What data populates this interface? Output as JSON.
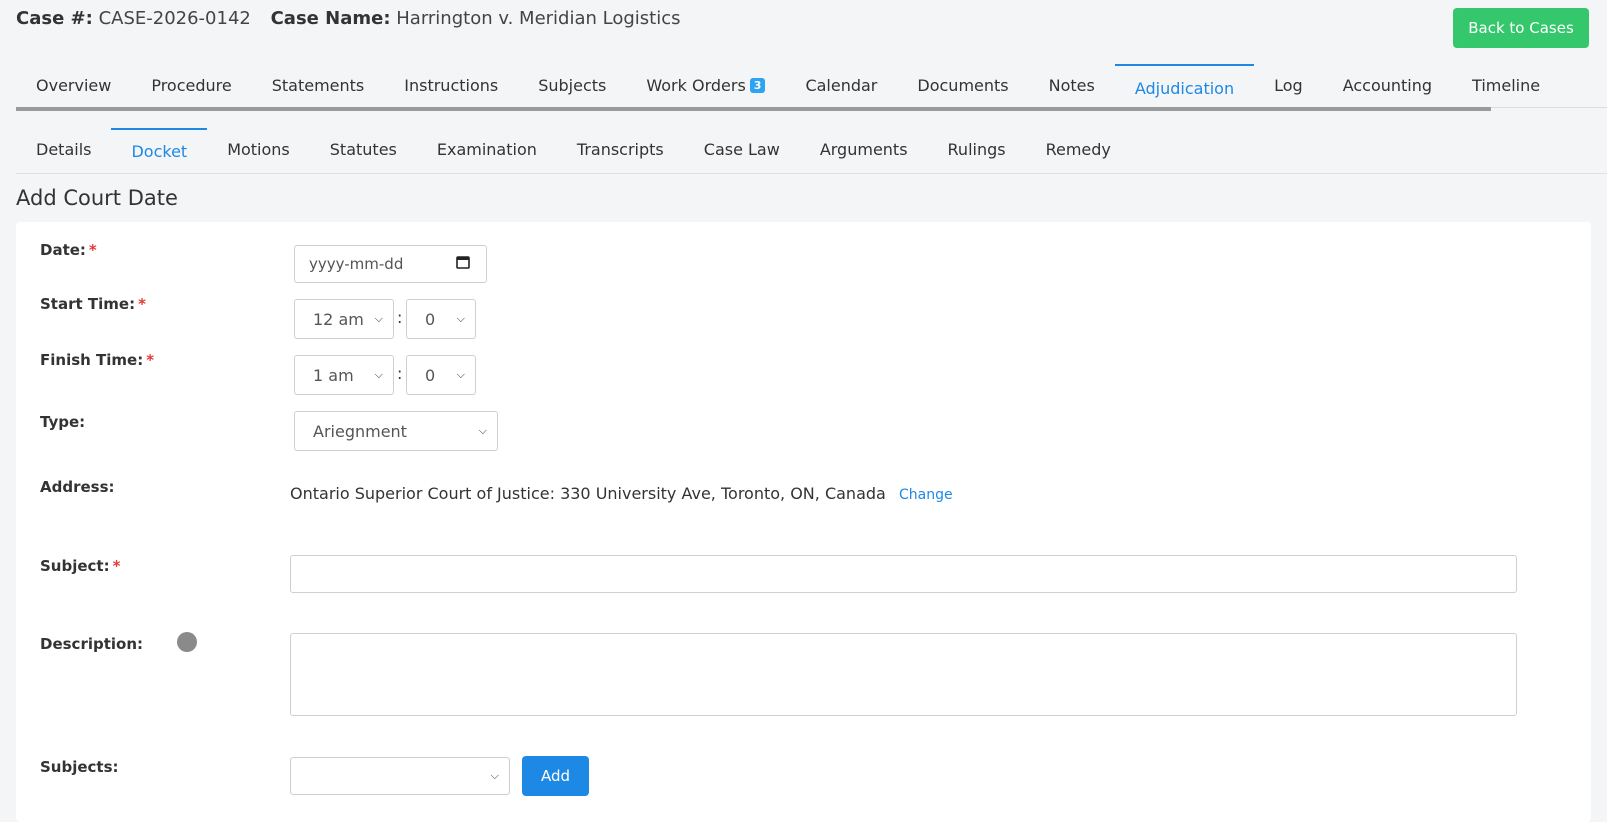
{
  "header": {
    "case_no_label": "Case #:",
    "case_no": "CASE-2026-0142",
    "case_name_label": "Case Name:",
    "case_name": "Harrington v. Meridian Logistics",
    "back_button": "Back to Cases"
  },
  "main_tabs": [
    {
      "label": "Overview"
    },
    {
      "label": "Procedure"
    },
    {
      "label": "Statements"
    },
    {
      "label": "Instructions"
    },
    {
      "label": "Subjects"
    },
    {
      "label": "Work Orders",
      "badge": "3"
    },
    {
      "label": "Calendar"
    },
    {
      "label": "Documents"
    },
    {
      "label": "Notes"
    },
    {
      "label": "Adjudication",
      "active": true
    },
    {
      "label": "Log"
    },
    {
      "label": "Accounting"
    },
    {
      "label": "Timeline"
    }
  ],
  "sub_tabs": [
    {
      "label": "Details"
    },
    {
      "label": "Docket",
      "active": true
    },
    {
      "label": "Motions"
    },
    {
      "label": "Statutes"
    },
    {
      "label": "Examination"
    },
    {
      "label": "Transcripts"
    },
    {
      "label": "Case Law"
    },
    {
      "label": "Arguments"
    },
    {
      "label": "Rulings"
    },
    {
      "label": "Remedy"
    }
  ],
  "form": {
    "title": "Add Court Date",
    "required_mark": "*",
    "date_label": "Date:",
    "date_placeholder": "yyyy-mm-dd",
    "start_label": "Start Time:",
    "start_hour": "12 am",
    "start_minute": "0",
    "finish_label": "Finish Time:",
    "finish_hour": "1 am",
    "finish_minute": "0",
    "time_separator": ":",
    "type_label": "Type:",
    "type_value": "Ariegnment",
    "address_label": "Address:",
    "address_value": "Ontario Superior Court of Justice: 330 University Ave, Toronto, ON, Canada",
    "change_link": "Change",
    "subject_label": "Subject:",
    "subject_value": "",
    "description_label": "Description:",
    "description_value": "",
    "subjects_label": "Subjects:",
    "subjects_value": "",
    "add_button": "Add"
  },
  "colors": {
    "accent": "#1e88e5",
    "success": "#34c76b",
    "required": "#e53935"
  }
}
